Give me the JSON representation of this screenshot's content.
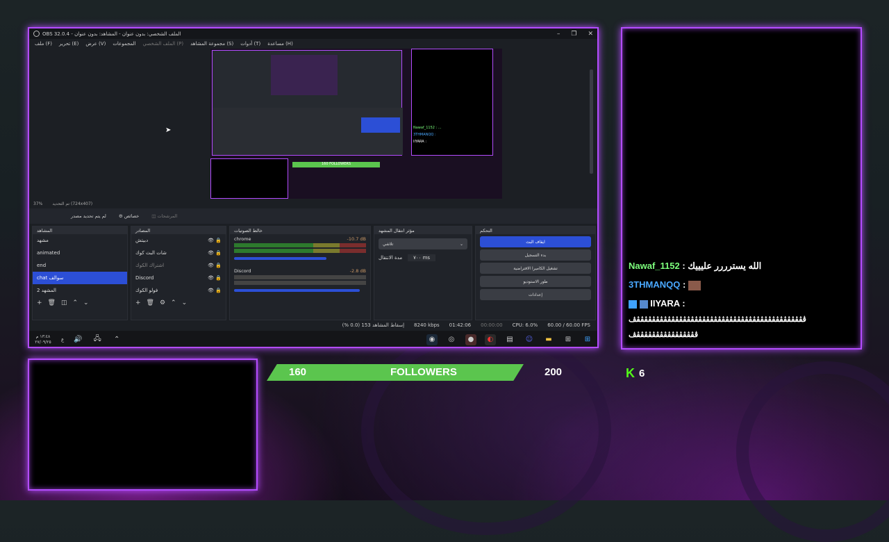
{
  "obs_window": {
    "title": "OBS 32.0.4 - الملف الشخصي: بدون عنوان - المشاهد: بدون عنوان",
    "menu": [
      "ملف (F)",
      "تحرير (E)",
      "عرض (V)",
      "المجموعات",
      "الملف الشخصي (P)",
      "مجموعة المشاهد (S)",
      "أدوات (T)",
      "مساعدة (H)"
    ],
    "zoom": "37%",
    "canvas_size": "تم التحديد (724x407)",
    "source_bar": {
      "no_source": "لم يتم تحديد مصدر",
      "properties": "خصائص",
      "filters": "المرشحات"
    },
    "scenes": {
      "title": "المشاهد",
      "items": [
        "مشهد",
        "animated",
        "end",
        "chat سوالف",
        "المشهد 2"
      ],
      "selected": "chat سوالف"
    },
    "sources": {
      "title": "المصادر",
      "items": [
        "دبيتش",
        "شات البث كوك",
        "اشتراك الكوك",
        "Discord",
        "فولو الكوك"
      ]
    },
    "audio_mixer": {
      "title": "خالط الصوتيات",
      "channels": [
        {
          "name": "chrome",
          "level": "-10.7 dB"
        },
        {
          "name": "Discord",
          "level": "-2.8 dB"
        }
      ],
      "scale": [
        "-60",
        "-55",
        "-50",
        "-45",
        "-40",
        "-35",
        "-30",
        "-25",
        "-20",
        "-15",
        "-10",
        "-5",
        "0"
      ]
    },
    "transitions": {
      "title": "مؤثر انتقال المشهد",
      "selected": "تلاشي",
      "duration_label": "مدة الانتقال",
      "duration": "٧٠٠ ms"
    },
    "controls": {
      "title": "التحكم",
      "buttons": [
        "ايقاف البث",
        "بدء التسجيل",
        "تشغيل الكاميرا الافتراضية",
        "طور الاستوديو",
        "إعدادات"
      ]
    },
    "status": {
      "dropped": "إسقاط المشاهد 153 (0.0 %)",
      "bitrate": "8240 kbps",
      "live_time": "01:42:06",
      "rec_time": "00:00:00",
      "cpu": "CPU: 6.0%",
      "fps": "60.00 / 60.00 FPS"
    }
  },
  "taskbar": {
    "time": "١٣:٤٨ م",
    "date": "٢٧/٠٩/٢٥",
    "lang": "ع"
  },
  "chat": {
    "lines": [
      {
        "user": "Nawaf_1152",
        "sep": " : ",
        "text": "الله يسترررر عليييك",
        "color": "#7dff7d"
      },
      {
        "user": "3THMANQQ",
        "sep": " : ",
        "text": "",
        "color": "#4aa8ff"
      },
      {
        "user": "IIYARA",
        "sep": " : ",
        "text": "",
        "color": "#ffffff"
      }
    ],
    "spam_line1": "ڤڤڤڤڤڤڤڤڤڤڤڤڤڤڤڤڤڤڤڤڤڤڤڤڤڤڤڤڤڤڤڤڤڤڤڤڤڤڤڤڤڤڤڤڤ",
    "spam_line2": "ڤڤڤڤڤڤڤڤڤڤڤڤڤڤڤڤڤ"
  },
  "followers": {
    "current": "160",
    "label": "FOLLOWERS",
    "goal": "200",
    "progress": 0.8
  },
  "kick": {
    "count": "6",
    "color": "#53fc18"
  },
  "colors": {
    "accent": "#b44cff",
    "bar": "#5bc54e",
    "obs_blue": "#2c4fd6"
  }
}
